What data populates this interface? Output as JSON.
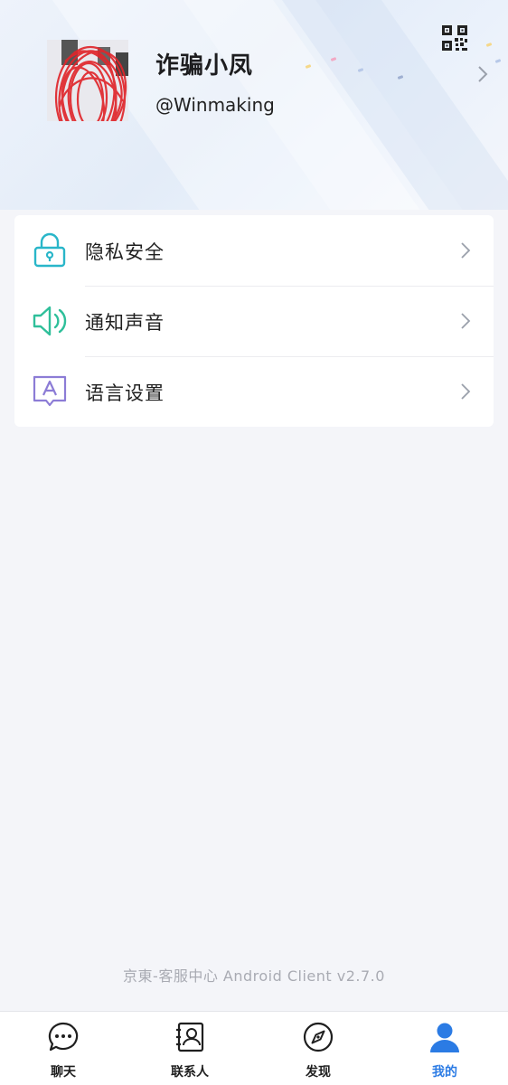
{
  "profile": {
    "name": "诈骗小凤",
    "handle": "@Winmaking"
  },
  "settings": [
    {
      "label": "隐私安全",
      "icon": "lock-icon"
    },
    {
      "label": "通知声音",
      "icon": "speaker-icon"
    },
    {
      "label": "语言设置",
      "icon": "language-icon"
    }
  ],
  "footer": {
    "version": "京東-客服中心  Android  Client  v2.7.0"
  },
  "tabs": [
    {
      "label": "聊天",
      "icon": "chat-bubble-icon",
      "active": false
    },
    {
      "label": "联系人",
      "icon": "contacts-card-icon",
      "active": false
    },
    {
      "label": "发现",
      "icon": "compass-icon",
      "active": false
    },
    {
      "label": "我的",
      "icon": "person-icon",
      "active": true
    }
  ],
  "colors": {
    "accent": "#2b7be4",
    "lock": "#29b6c9",
    "speaker": "#2fbf9a",
    "language": "#8c7cd6"
  }
}
